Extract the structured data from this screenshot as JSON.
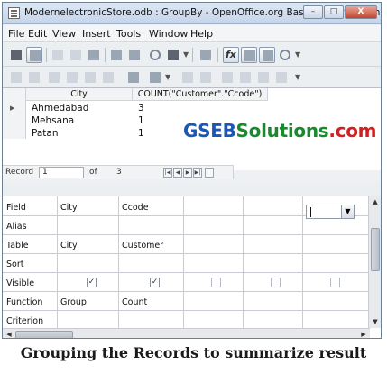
{
  "window": {
    "title": "ModernelectronicStore.odb : GroupBy - OpenOffice.org Base: Query Design",
    "controls": {
      "minimize": "–",
      "maximize": "□",
      "close": "X"
    }
  },
  "menu": [
    "File",
    "Edit",
    "View",
    "Insert",
    "Tools",
    "Window",
    "Help"
  ],
  "toolbar1": {
    "icons": [
      "save-icon",
      "edit-icon",
      "cut-icon",
      "copy-icon",
      "paste-icon",
      "undo-icon",
      "add-tables-icon",
      "sql-icon",
      "clear-icon",
      "design-view-icon",
      "functions-icon",
      "table-name-icon",
      "alias-icon",
      "distinct-icon"
    ],
    "functions_label": "fx"
  },
  "toolbar2": {
    "icons": [
      "save-record-icon",
      "edit-data-icon",
      "cut-icon",
      "copy-icon",
      "paste-icon",
      "undo-icon",
      "find-icon",
      "refresh-icon",
      "sort-ascending-icon",
      "sort-descending-icon",
      "autofilter-icon",
      "standard-filter-icon",
      "remove-filter-icon",
      "apply-filter-icon"
    ]
  },
  "results": {
    "columns": [
      "City",
      "COUNT(\"Customer\".\"Ccode\")"
    ],
    "rows": [
      {
        "city": "Ahmedabad",
        "count": "3"
      },
      {
        "city": "Mehsana",
        "count": "1"
      },
      {
        "city": "Patan",
        "count": "1"
      }
    ]
  },
  "watermark": {
    "part1": "GSEB",
    "part2": "Solutions",
    "part3": ".com"
  },
  "navigation": {
    "record_label": "Record",
    "current": "1",
    "of_label": "of",
    "total": "3"
  },
  "grid": {
    "row_labels": [
      "Field",
      "Alias",
      "Table",
      "Sort",
      "Visible",
      "Function",
      "Criterion"
    ],
    "columns": [
      {
        "field": "City",
        "alias": "",
        "table": "City",
        "sort": "",
        "visible": true,
        "function": "Group"
      },
      {
        "field": "Ccode",
        "alias": "",
        "table": "Customer",
        "sort": "",
        "visible": true,
        "function": "Count"
      },
      {
        "field": "",
        "alias": "",
        "table": "",
        "sort": "",
        "visible": false,
        "function": ""
      },
      {
        "field": "",
        "alias": "",
        "table": "",
        "sort": "",
        "visible": false,
        "function": ""
      },
      {
        "field": "",
        "alias": "",
        "table": "",
        "sort": "",
        "visible": false,
        "function": ""
      }
    ],
    "check_mark": "✓"
  },
  "caption": "Grouping the Records to summarize result"
}
